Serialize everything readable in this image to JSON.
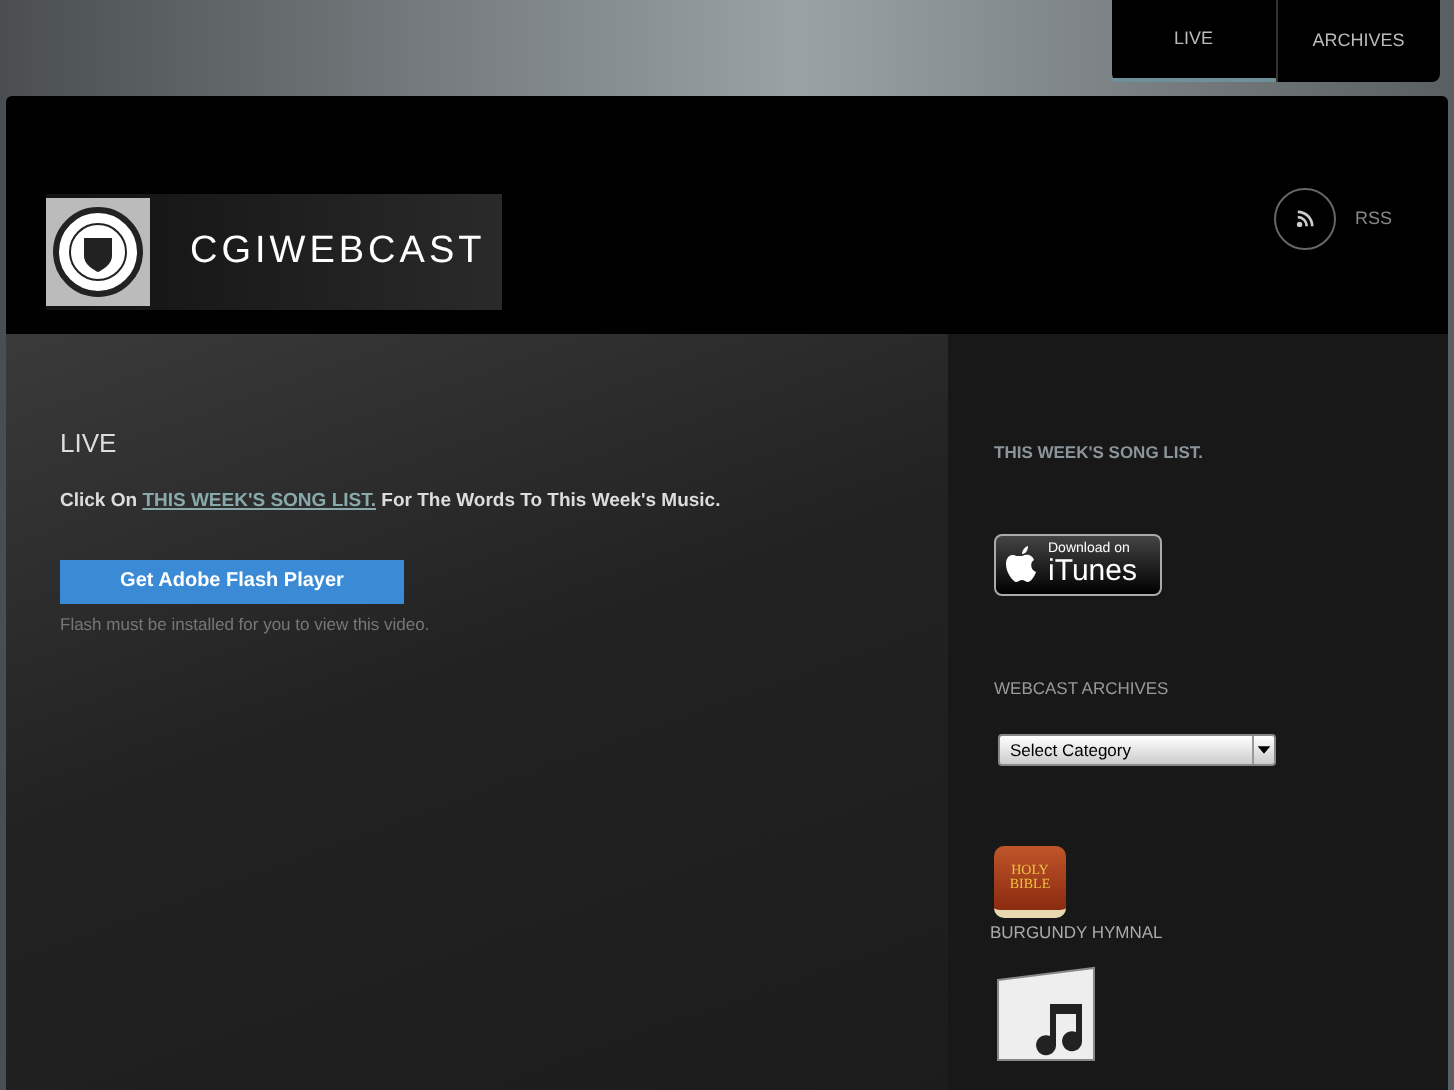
{
  "nav": [
    {
      "label": "LIVE",
      "selected": true
    },
    {
      "label": "ARCHIVES",
      "selected": false
    }
  ],
  "header": {
    "logo_text": "CGIWEBCAST",
    "rss": "RSS"
  },
  "main": {
    "title": "LIVE",
    "intro_before": "Click On",
    "intro_link": "THIS WEEK'S SONG LIST.",
    "intro_after": "For The Words To This Week's Music.",
    "flash_button": "Get Adobe Flash Player",
    "flash_note": "Flash must be installed for you to view this video."
  },
  "sidebar": {
    "song_list": "THIS WEEK'S SONG LIST.",
    "itunes_small": "Download on",
    "itunes_big": "iTunes",
    "archives_title": "WEBCAST ARCHIVES",
    "select_value": "Select Category",
    "bible_line1": "HOLY",
    "bible_line2": "BIBLE",
    "hymnal": "BURGUNDY HYMNAL"
  }
}
